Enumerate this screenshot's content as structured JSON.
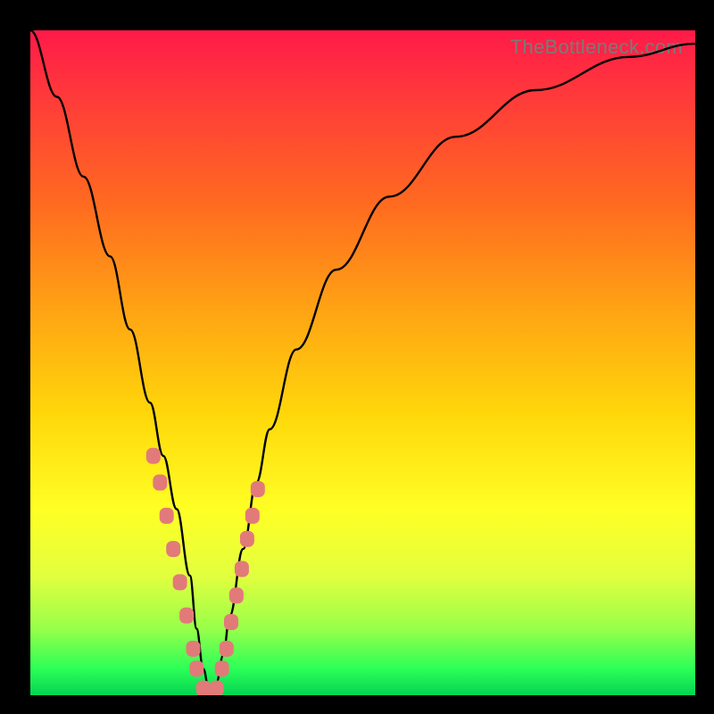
{
  "watermark": "TheBottleneck.com",
  "chart_data": {
    "type": "line",
    "title": "",
    "xlabel": "",
    "ylabel": "",
    "xlim": [
      0,
      100
    ],
    "ylim": [
      0,
      100
    ],
    "background_gradient": [
      "#ff1a49",
      "#ffff24",
      "#04d453"
    ],
    "series": [
      {
        "name": "bottleneck-curve",
        "x": [
          0,
          4,
          8,
          12,
          15,
          18,
          20,
          22,
          24,
          25,
          26,
          27,
          28,
          29,
          30,
          32,
          34,
          36,
          40,
          46,
          54,
          64,
          76,
          90,
          100
        ],
        "y": [
          100,
          90,
          78,
          66,
          55,
          44,
          36,
          28,
          18,
          10,
          4,
          0,
          2,
          6,
          12,
          22,
          32,
          40,
          52,
          64,
          75,
          84,
          91,
          96,
          98
        ]
      }
    ],
    "scatter": {
      "name": "highlighted-points",
      "x": [
        18.5,
        19.5,
        20.5,
        21.5,
        22.5,
        23.5,
        24.5,
        25.0,
        26.0,
        27.0,
        28.0,
        28.8,
        29.5,
        30.2,
        31.0,
        31.8,
        32.6,
        33.4,
        34.2
      ],
      "y": [
        36,
        32,
        27,
        22,
        17,
        12,
        7,
        4,
        1,
        0,
        1,
        4,
        7,
        11,
        15,
        19,
        23.5,
        27,
        31
      ]
    }
  }
}
